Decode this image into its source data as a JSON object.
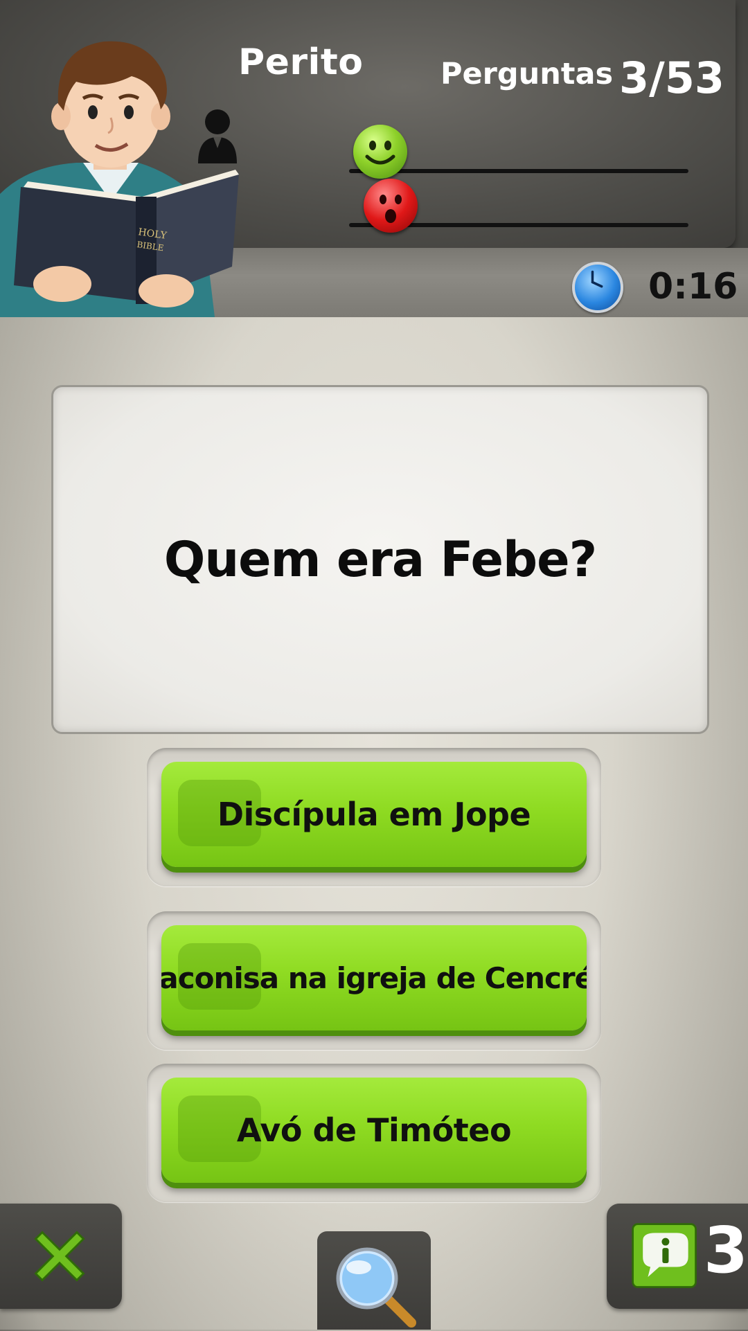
{
  "header": {
    "level_title": "Perito",
    "questions_label": "Perguntas",
    "questions_count": "3/53",
    "timer": "0:16",
    "icons": {
      "player": "player-silhouette-icon",
      "correct": "happy-smiley-icon",
      "wrong": "sad-smiley-icon",
      "clock": "clock-icon"
    }
  },
  "question": {
    "text": "Quem era Febe?"
  },
  "answers": [
    {
      "label": "Discípula em Jope"
    },
    {
      "label": "Diaconisa na igreja de Cencréia"
    },
    {
      "label": "Avó de Timóteo"
    }
  ],
  "footer": {
    "hints_remaining": "3",
    "icons": {
      "close": "close-x-icon",
      "search": "magnifier-icon",
      "hint": "info-speech-bubble-icon"
    }
  },
  "colors": {
    "answer_green": "#8fdb22",
    "header_dark": "#4b4a46",
    "correct": "#8ed12a",
    "wrong": "#e01818"
  }
}
